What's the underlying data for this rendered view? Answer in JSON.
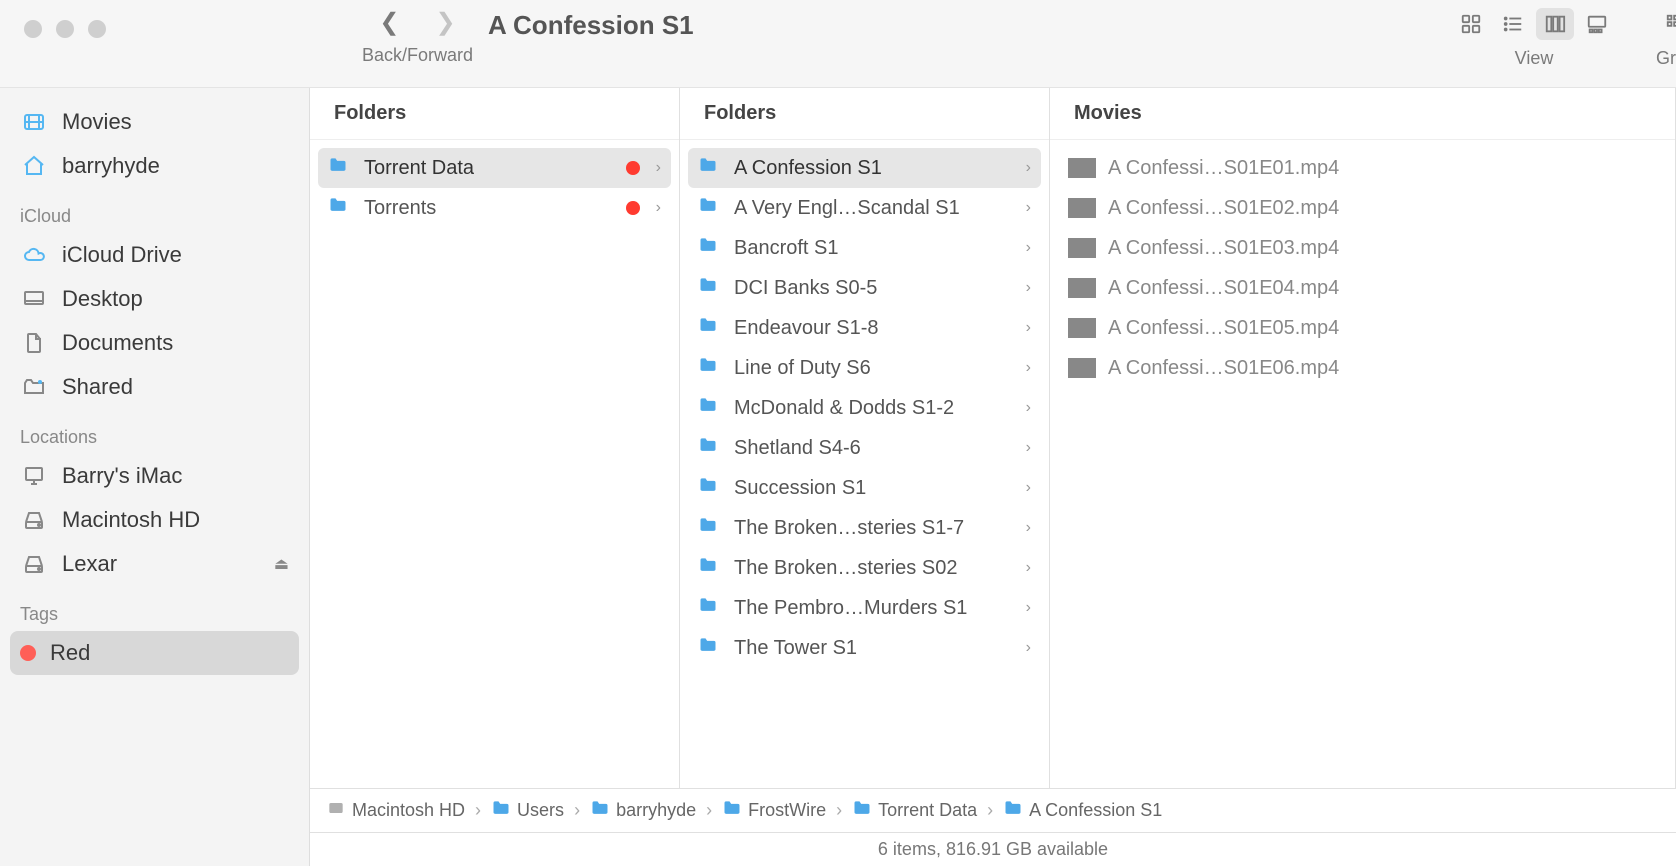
{
  "window": {
    "title": "A Confession S1"
  },
  "toolbar": {
    "back_forward_label": "Back/Forward",
    "view_label": "View",
    "group_label": "Grou"
  },
  "sidebar": {
    "favorites": [
      {
        "id": "movies",
        "label": "Movies",
        "icon": "movies"
      },
      {
        "id": "home",
        "label": "barryhyde",
        "icon": "home"
      }
    ],
    "sections": [
      {
        "header": "iCloud",
        "items": [
          {
            "id": "iclouddrive",
            "label": "iCloud Drive",
            "icon": "cloud"
          },
          {
            "id": "desktop",
            "label": "Desktop",
            "icon": "desktop"
          },
          {
            "id": "documents",
            "label": "Documents",
            "icon": "document"
          },
          {
            "id": "shared",
            "label": "Shared",
            "icon": "shared"
          }
        ]
      },
      {
        "header": "Locations",
        "items": [
          {
            "id": "imac",
            "label": "Barry's iMac",
            "icon": "computer"
          },
          {
            "id": "machd",
            "label": "Macintosh HD",
            "icon": "disk"
          },
          {
            "id": "lexar",
            "label": "Lexar",
            "icon": "disk",
            "ejectable": true
          }
        ]
      },
      {
        "header": "Tags",
        "items": [
          {
            "id": "red",
            "label": "Red",
            "icon": "tag-red",
            "selected": true
          }
        ]
      }
    ]
  },
  "columns": [
    {
      "header": "Folders",
      "items": [
        {
          "name": "Torrent Data",
          "type": "folder",
          "tag": "red",
          "selected": true,
          "hasChildren": true
        },
        {
          "name": "Torrents",
          "type": "folder",
          "tag": "red",
          "hasChildren": true
        }
      ]
    },
    {
      "header": "Folders",
      "items": [
        {
          "name": "A Confession S1",
          "type": "folder",
          "selected": true,
          "hasChildren": true
        },
        {
          "name": "A Very Engl…Scandal S1",
          "type": "folder",
          "hasChildren": true
        },
        {
          "name": "Bancroft S1",
          "type": "folder",
          "hasChildren": true
        },
        {
          "name": "DCI Banks S0-5",
          "type": "folder",
          "hasChildren": true
        },
        {
          "name": "Endeavour S1-8",
          "type": "folder",
          "hasChildren": true
        },
        {
          "name": "Line of Duty S6",
          "type": "folder",
          "hasChildren": true
        },
        {
          "name": "McDonald & Dodds S1-2",
          "type": "folder",
          "hasChildren": true
        },
        {
          "name": "Shetland S4-6",
          "type": "folder",
          "hasChildren": true
        },
        {
          "name": "Succession S1",
          "type": "folder",
          "hasChildren": true
        },
        {
          "name": "The Broken…steries S1-7",
          "type": "folder",
          "hasChildren": true
        },
        {
          "name": "The Broken…steries S02",
          "type": "folder",
          "hasChildren": true
        },
        {
          "name": "The Pembro…Murders S1",
          "type": "folder",
          "hasChildren": true
        },
        {
          "name": "The Tower S1",
          "type": "folder",
          "hasChildren": true
        }
      ]
    },
    {
      "header": "Movies",
      "items": [
        {
          "name": "A Confessi…S01E01.mp4",
          "type": "file"
        },
        {
          "name": "A Confessi…S01E02.mp4",
          "type": "file"
        },
        {
          "name": "A Confessi…S01E03.mp4",
          "type": "file"
        },
        {
          "name": "A Confessi…S01E04.mp4",
          "type": "file"
        },
        {
          "name": "A Confessi…S01E05.mp4",
          "type": "file"
        },
        {
          "name": "A Confessi…S01E06.mp4",
          "type": "file"
        }
      ]
    }
  ],
  "pathbar": [
    {
      "label": "Macintosh HD",
      "icon": "disk"
    },
    {
      "label": "Users",
      "icon": "folder"
    },
    {
      "label": "barryhyde",
      "icon": "home-folder"
    },
    {
      "label": "FrostWire",
      "icon": "folder"
    },
    {
      "label": "Torrent Data",
      "icon": "folder"
    },
    {
      "label": "A Confession S1",
      "icon": "folder"
    }
  ],
  "statusbar": {
    "text": "6 items, 816.91 GB available"
  }
}
